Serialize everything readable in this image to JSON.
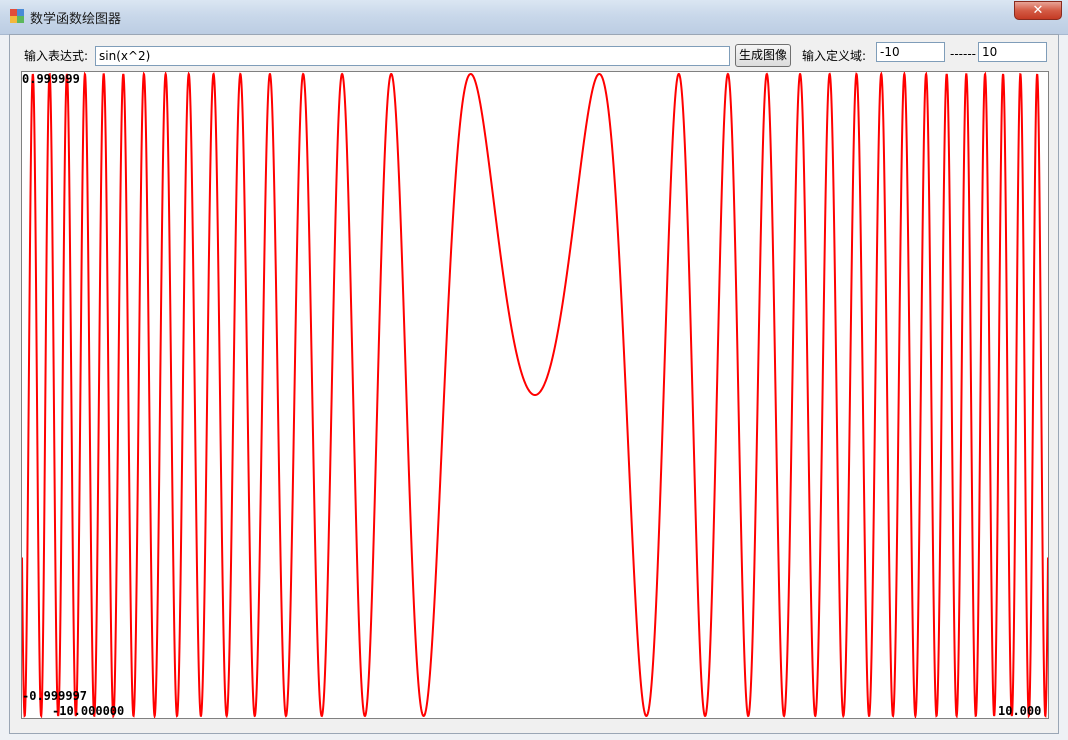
{
  "window": {
    "title": "数学函数绘图器",
    "close_label": "✕"
  },
  "form": {
    "expression_label": "输入表达式:",
    "expression_value": "sin(x^2)",
    "generate_label": "生成图像",
    "domain_label": "输入定义域:",
    "domain_min": "-10",
    "domain_separator": "------",
    "domain_max": "10"
  },
  "colors": {
    "curve": "#ff0000",
    "plot_bg": "#ffffff"
  },
  "chart_data": {
    "type": "line",
    "series": [
      {
        "expression": "sin(x^2)",
        "x_range": [
          -10,
          10
        ],
        "samples": 4000
      }
    ],
    "y_max_label": "0.999999",
    "y_min_label": "-0.999997",
    "x_min_label": "-10.000000",
    "x_max_label": "10.000",
    "ylim": [
      -1,
      1
    ],
    "xlim": [
      -10,
      10
    ],
    "grid": false
  }
}
